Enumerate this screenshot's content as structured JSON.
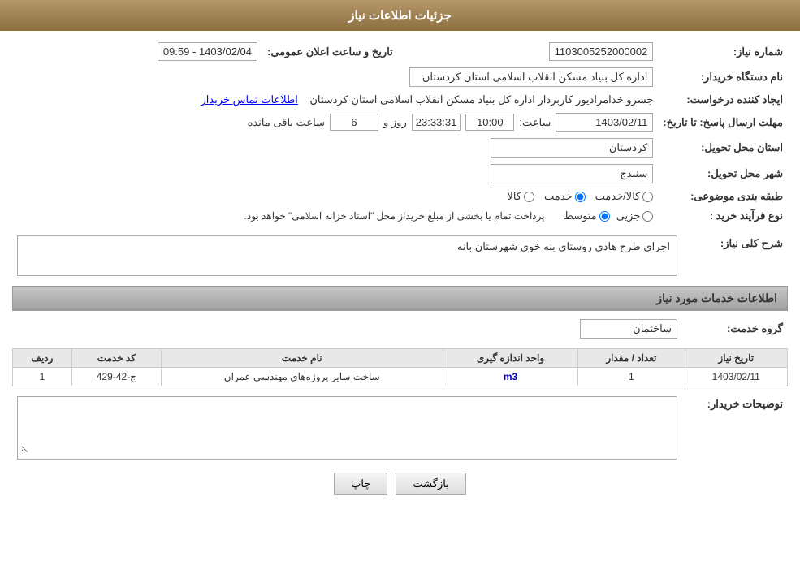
{
  "header": {
    "title": "جزئیات اطلاعات نیاز"
  },
  "fields": {
    "shomareNiaz_label": "شماره نیاز:",
    "shomareNiaz_value": "1103005252000002",
    "dateTime_label": "تاریخ و ساعت اعلان عمومی:",
    "dateTime_value": "1403/02/04 - 09:59",
    "namDasgah_label": "نام دستگاه خریدار:",
    "namDasgah_value": "اداره کل بنیاد مسکن انقلاب اسلامی استان کردستان",
    "ijadKonande_label": "ایجاد کننده درخواست:",
    "ijadKonande_value": "جسرو خدامرادیور کاربردار اداره کل بنیاد مسکن انقلاب اسلامی استان کردستان",
    "etelaatTamas_label": "اطلاعات تماس خریدار",
    "mohlat_label": "مهلت ارسال پاسخ: تا تاریخ:",
    "mohlat_date": "1403/02/11",
    "mohlat_time_label": "ساعت:",
    "mohlat_time": "10:00",
    "mohlat_roz_label": "روز و",
    "mohlat_roz": "6",
    "mohlat_saat_label": "ساعت باقی مانده",
    "mohlat_countdown": "23:33:31",
    "ostan_label": "استان محل تحویل:",
    "ostan_value": "کردستان",
    "shahr_label": "شهر محل تحویل:",
    "shahr_value": "سنندج",
    "tabaqe_label": "طبقه بندی موضوعی:",
    "tabaqe_kala": "کالا",
    "tabaqe_khedmat": "خدمت",
    "tabaqe_kala_khedmat": "کالا/خدمت",
    "tabaqe_selected": "khedmat",
    "noveFarayand_label": "نوع فرآیند خرید :",
    "noveFarayand_jozyi": "جزیی",
    "noveFarayand_motavaset": "متوسط",
    "noveFarayand_selected": "motavaset",
    "noveFarayand_notice": "پرداخت تمام یا بخشی از مبلغ خریداز محل \"اسناد خزانه اسلامی\" خواهد بود.",
    "sharhNiaz_label": "شرح کلی نیاز:",
    "sharhNiaz_value": "اجرای طرح هادی روستای بنه خوی شهرستان بانه",
    "khadamat_title": "اطلاعات خدمات مورد نیاز",
    "groupeKhedmat_label": "گروه خدمت:",
    "groupeKhedmat_value": "ساختمان",
    "table": {
      "col_radif": "ردیف",
      "col_kod": "کد خدمت",
      "col_name": "نام خدمت",
      "col_vahed": "واحد اندازه گیری",
      "col_tedad": "تعداد / مقدار",
      "col_tarikh": "تاریخ نیاز",
      "rows": [
        {
          "radif": "1",
          "kod": "ج-42-429",
          "name": "ساخت سایر پروژه‌های مهندسی عمران",
          "vahed": "m3",
          "tedad": "1",
          "tarikh": "1403/02/11"
        }
      ]
    },
    "tawzihKharidar_label": "توضیحات خریدار:",
    "tawzihKharidar_value": ""
  },
  "buttons": {
    "chap": "چاپ",
    "bazgasht": "بازگشت"
  }
}
